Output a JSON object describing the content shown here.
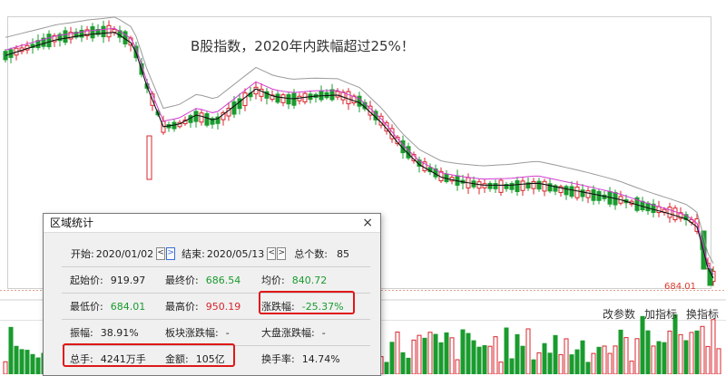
{
  "annotation": "B股指数，2020年内跌幅超过25%！",
  "last_price_label": "684.01",
  "sub_toolbar": {
    "modify_params": "改参数",
    "add_indicator": "加指标",
    "switch_indicator": "换指标"
  },
  "dialog": {
    "title": "区域统计",
    "close": "×",
    "range": {
      "start_label": "开始:",
      "start_value": "2020/01/02",
      "end_label": "结束:",
      "end_value": "2020/05/13",
      "count_label": "总个数:",
      "count_value": "85",
      "prev_glyph": "<",
      "next_glyph": ">"
    },
    "rows": [
      [
        {
          "label": "起始价:",
          "value": "919.97",
          "color": "black"
        },
        {
          "label": "最终价:",
          "value": "686.54",
          "color": "green"
        },
        {
          "label": "均价:",
          "value": "840.72",
          "color": "green"
        }
      ],
      [
        {
          "label": "最低价:",
          "value": "684.01",
          "color": "green"
        },
        {
          "label": "最高价:",
          "value": "950.19",
          "color": "red"
        },
        {
          "label": "涨跌幅:",
          "value": "-25.37%",
          "color": "green"
        }
      ],
      [
        {
          "label": "振幅:",
          "value": "38.91%",
          "color": "black"
        },
        {
          "label": "板块涨跌幅:",
          "value": "-",
          "color": "black"
        },
        {
          "label": "大盘涨跌幅:",
          "value": "-",
          "color": "black"
        }
      ],
      [
        {
          "label": "总手:",
          "value": "4241万手",
          "color": "black"
        },
        {
          "label": "金额:",
          "value": "105亿",
          "color": "black"
        },
        {
          "label": "换手率:",
          "value": "14.74%",
          "color": "black"
        }
      ]
    ]
  },
  "colors": {
    "up": "#d8262c",
    "down": "#1a9b2e",
    "ma_short": "#111111",
    "ma_mid": "#d23ad0",
    "ma_long": "#9a9a9a",
    "highlight": "#e01818"
  }
}
